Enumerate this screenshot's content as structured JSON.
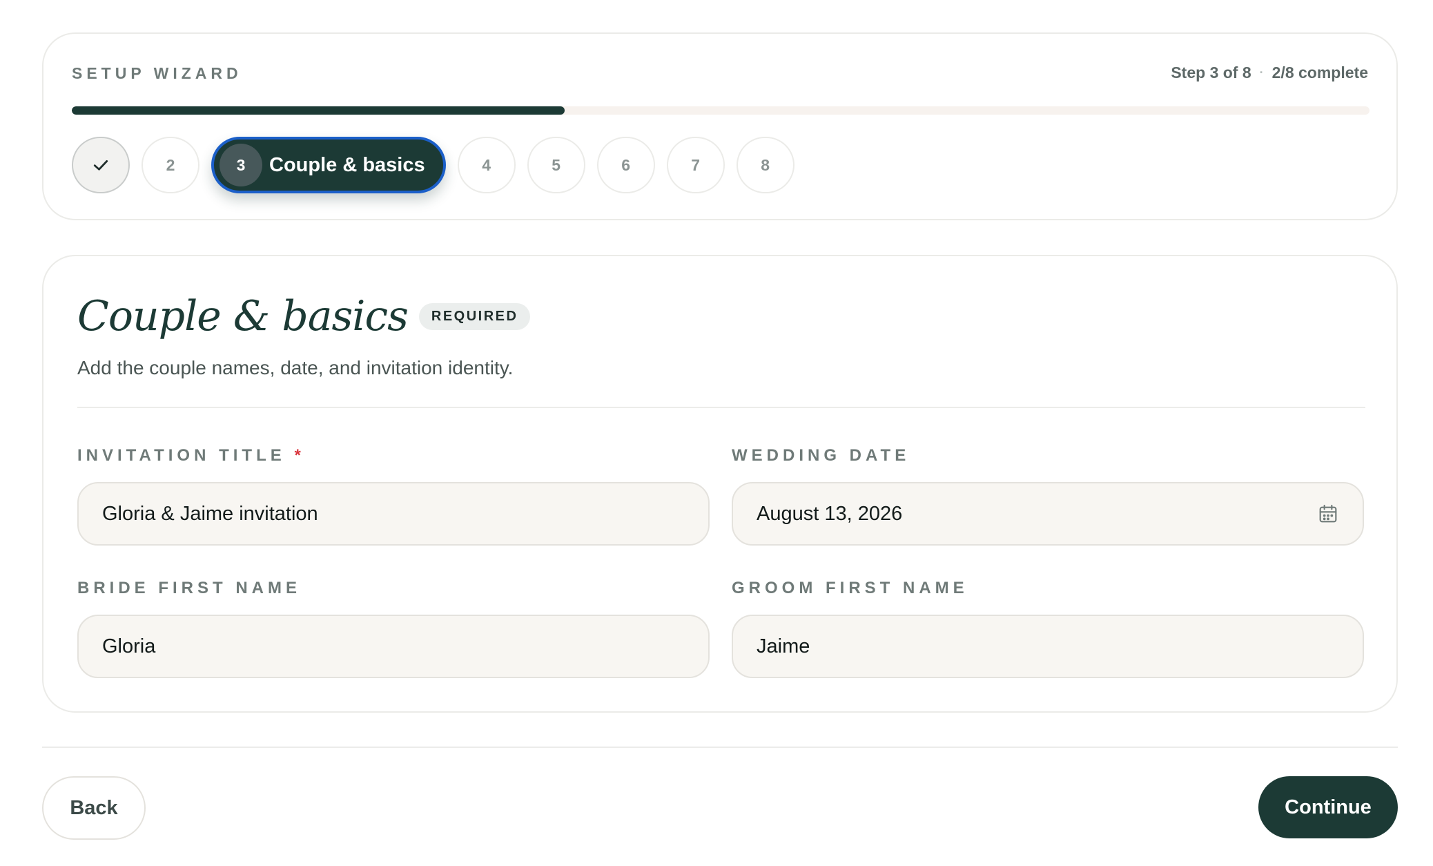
{
  "wizard": {
    "label": "SETUP WIZARD",
    "step_text": "Step 3 of 8",
    "separator": "·",
    "complete_text": "2/8 complete",
    "progress_fraction": 0.38,
    "steps": [
      {
        "number": "1",
        "state": "done",
        "icon": "check-icon"
      },
      {
        "number": "2",
        "state": "upcoming"
      },
      {
        "number": "3",
        "state": "active",
        "label": "Couple & basics"
      },
      {
        "number": "4",
        "state": "upcoming"
      },
      {
        "number": "5",
        "state": "upcoming"
      },
      {
        "number": "6",
        "state": "upcoming"
      },
      {
        "number": "7",
        "state": "upcoming"
      },
      {
        "number": "8",
        "state": "upcoming"
      }
    ]
  },
  "section": {
    "title": "Couple & basics",
    "badge": "REQUIRED",
    "subtitle": "Add the couple names, date, and invitation identity."
  },
  "fields": {
    "invitation_title": {
      "label": "INVITATION TITLE",
      "required_mark": "*",
      "value": "Gloria & Jaime invitation"
    },
    "wedding_date": {
      "label": "WEDDING DATE",
      "value": "August 13, 2026",
      "icon": "calendar-icon"
    },
    "bride_first_name": {
      "label": "BRIDE FIRST NAME",
      "value": "Gloria"
    },
    "groom_first_name": {
      "label": "GROOM FIRST NAME",
      "value": "Jaime"
    }
  },
  "footer": {
    "back_label": "Back",
    "continue_label": "Continue"
  },
  "colors": {
    "primary": "#1c3a35",
    "active_ring": "#1b5fc9",
    "required_star": "#d9363e",
    "field_bg": "#f8f6f2"
  }
}
